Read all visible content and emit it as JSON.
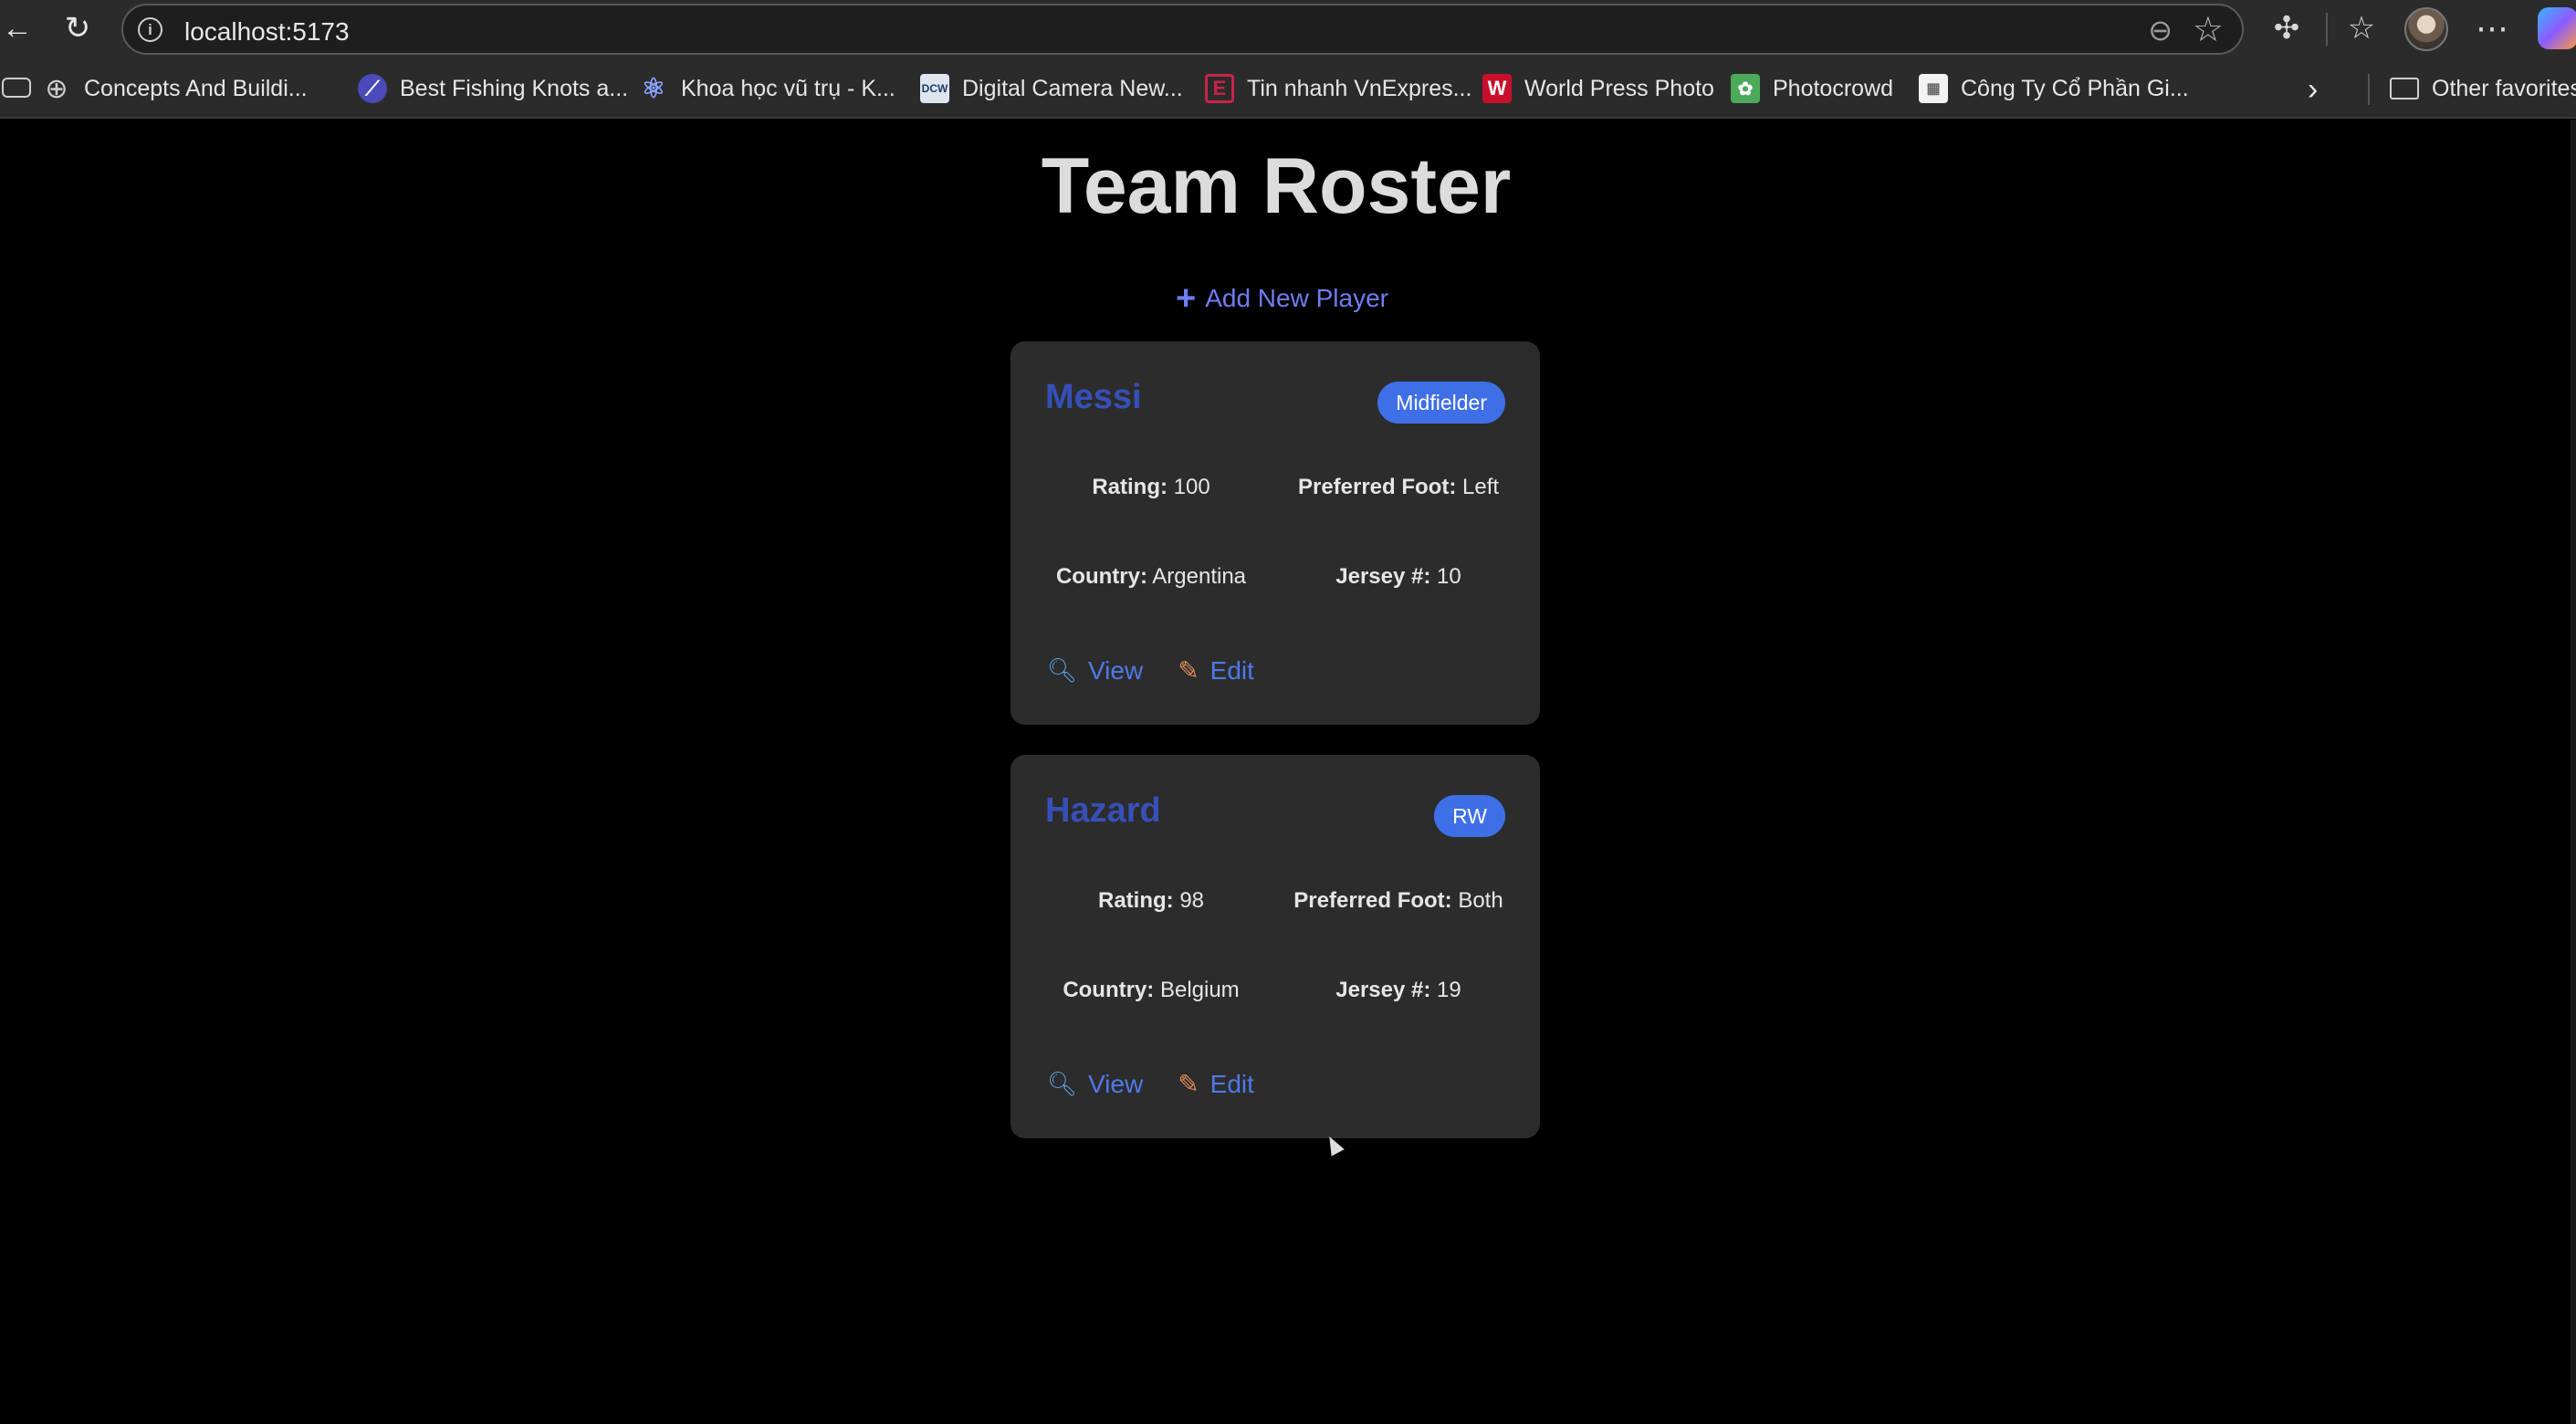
{
  "browser": {
    "url": "localhost:5173",
    "bookmarks": [
      {
        "label": "Concepts And Buildi...",
        "icon": "globe-icon"
      },
      {
        "label": "Best Fishing Knots a...",
        "icon": "fishing-icon"
      },
      {
        "label": "Khoa học vũ trụ - K...",
        "icon": "atom-icon"
      },
      {
        "label": "Digital Camera New...",
        "icon": "dcw-icon",
        "icon_text": "DCW"
      },
      {
        "label": "Tin nhanh VnExpres...",
        "icon": "vnexpress-icon",
        "icon_text": "E"
      },
      {
        "label": "World Press Photo",
        "icon": "wpp-icon",
        "icon_text": "W"
      },
      {
        "label": "Photocrowd",
        "icon": "photocrowd-icon"
      },
      {
        "label": "Công Ty Cổ Phần Gi...",
        "icon": "company-icon"
      }
    ],
    "other_favorites": "Other favorites"
  },
  "page": {
    "title": "Team Roster",
    "add_player_label": "Add New Player",
    "players": [
      {
        "name": "Messi",
        "position": "Midfielder",
        "rating_label": "Rating:",
        "rating": "100",
        "foot_label": "Preferred Foot:",
        "foot": "Left",
        "country_label": "Country:",
        "country": "Argentina",
        "jersey_label": "Jersey #:",
        "jersey": "10",
        "view_label": "View",
        "edit_label": "Edit"
      },
      {
        "name": "Hazard",
        "position": "RW",
        "rating_label": "Rating:",
        "rating": "98",
        "foot_label": "Preferred Foot:",
        "foot": "Both",
        "country_label": "Country:",
        "country": "Belgium",
        "jersey_label": "Jersey #:",
        "jersey": "19",
        "view_label": "View",
        "edit_label": "Edit"
      }
    ]
  },
  "colors": {
    "accent_link": "#6f7ef0",
    "player_name": "#3650b8",
    "badge": "#3f6fe6",
    "card_bg": "#2c2c2c",
    "page_bg": "#000000"
  }
}
